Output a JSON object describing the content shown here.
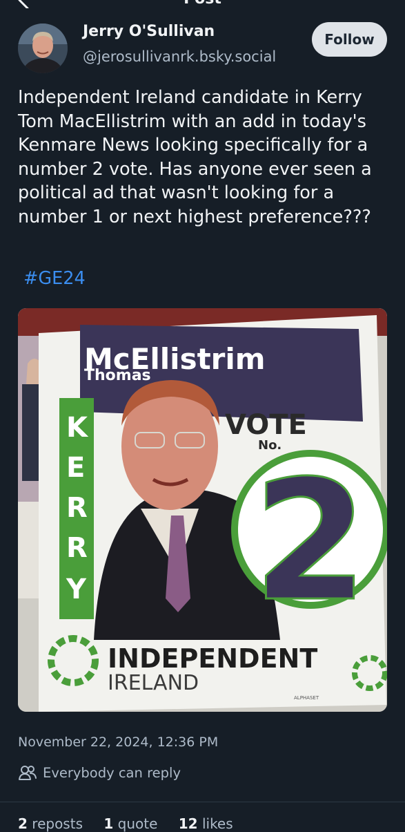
{
  "header": {
    "title": "Post"
  },
  "author": {
    "name": "Jerry O'Sullivan",
    "handle": "@jerosullivanrk.bsky.social",
    "follow_label": "Follow"
  },
  "post": {
    "text": "Independent Ireland candidate in Kerry Tom MacEllistrim with an add in today's Kenmare News looking specifically for a number 2 vote. Has anyone ever seen a political ad that wasn't looking for a number 1 or next highest preference???",
    "hashtag": "#GE24",
    "timestamp": "November 22, 2024, 12:36 PM",
    "reply_setting": "Everybody can reply"
  },
  "poster": {
    "surname": "McEllistrim",
    "first_name": "Thomas",
    "county": "KERRY",
    "vote_text": "VOTE",
    "no_text": "No.",
    "number": "2",
    "party_line1": "INDEPENDENT",
    "party_line2": "IRELAND",
    "credit": "ALPHASET"
  },
  "stats": {
    "reposts_count": "2",
    "reposts_label": "reposts",
    "quotes_count": "1",
    "quotes_label": "quote",
    "likes_count": "12",
    "likes_label": "likes"
  },
  "colors": {
    "background": "#161e27",
    "link": "#3b8ef0",
    "muted": "#aebbc9",
    "poster_green": "#4a9e3a",
    "poster_purple": "#3b3558"
  }
}
